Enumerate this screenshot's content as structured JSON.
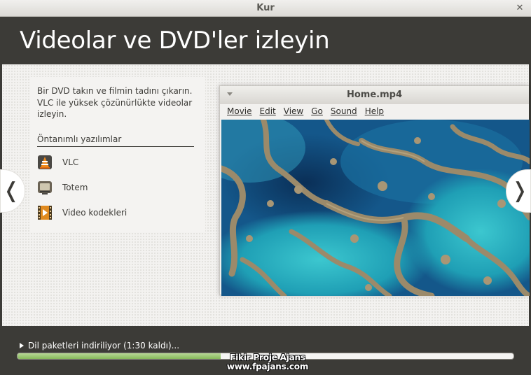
{
  "window": {
    "title": "Kur",
    "close_glyph": "✕"
  },
  "header": {
    "title": "Videolar ve DVD'ler izleyin"
  },
  "left": {
    "description": "Bir DVD takın ve filmin tadını çıkarın. VLC ile yüksek çözünürlükte videolar izleyin.",
    "section_title": "Öntanımlı yazılımlar",
    "apps": [
      {
        "label": "VLC",
        "icon": "vlc-cone-icon"
      },
      {
        "label": "Totem",
        "icon": "tv-icon"
      },
      {
        "label": "Video kodekleri",
        "icon": "film-play-icon"
      }
    ]
  },
  "nav": {
    "prev_glyph": "❬",
    "next_glyph": "❭"
  },
  "player": {
    "title": "Home.mp4",
    "menu": [
      "Movie",
      "Edit",
      "View",
      "Go",
      "Sound",
      "Help"
    ],
    "video_description": "aerial coral reef footage"
  },
  "footer": {
    "status": "Dil paketleri indiriliyor (1:30 kaldı)...",
    "progress": 0.41,
    "watermark_line1": "Fikir Proje Ajans",
    "watermark_line2": "www.fpajans.com"
  },
  "colors": {
    "header_bg": "#3c3b37",
    "progress_green": "#86b95a",
    "ocean_deep": "#0f3e68",
    "reef_tan": "#9b8a6a",
    "reef_turquoise": "#2fb6c1"
  }
}
